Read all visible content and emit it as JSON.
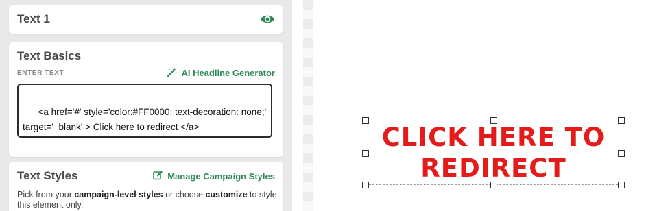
{
  "layer": {
    "title": "Text 1",
    "visibility_icon": "eye-icon",
    "accent": "#2f8a58"
  },
  "text_basics": {
    "title": "Text Basics",
    "field_label": "ENTER TEXT",
    "ai_link_label": "AI Headline Generator",
    "ai_link_icon": "magic-wand-icon",
    "textarea_value": "<a href='#' style='color:#FF0000; text-decoration: none;' target='_blank' > Click here to redirect </a>"
  },
  "text_styles": {
    "title": "Text Styles",
    "manage_link_label": "Manage Campaign Styles",
    "manage_link_icon": "edit-icon",
    "desc_part1": "Pick from your ",
    "desc_bold1": "campaign-level styles",
    "desc_part2": " or choose ",
    "desc_bold2": "customize",
    "desc_part3": " to style this element only."
  },
  "canvas": {
    "link_text": "Click here to redirect",
    "link_color": "#e31b1b"
  }
}
